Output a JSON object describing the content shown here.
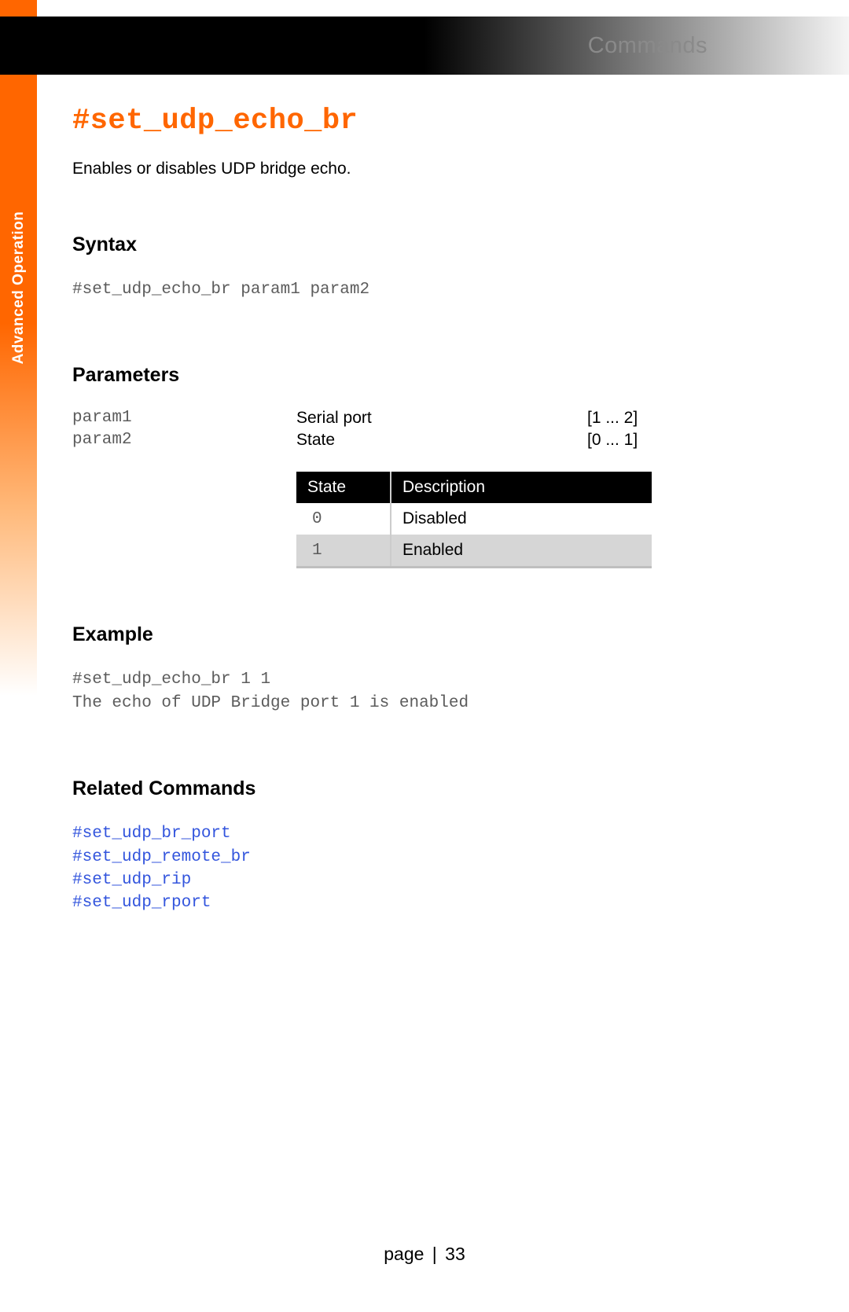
{
  "header": {
    "title": "Commands"
  },
  "sidebar": {
    "label": "Advanced Operation"
  },
  "command": {
    "title": "#set_udp_echo_br",
    "description": "Enables or disables UDP bridge echo."
  },
  "syntax": {
    "heading": "Syntax",
    "code": "#set_udp_echo_br param1 param2"
  },
  "parameters": {
    "heading": "Parameters",
    "rows": [
      {
        "name": "param1",
        "desc": "Serial port",
        "range": "[1 ... 2]"
      },
      {
        "name": "param2",
        "desc": "State",
        "range": "[0 ... 1]"
      }
    ],
    "state_table": {
      "headers": {
        "state": "State",
        "desc": "Description"
      },
      "rows": [
        {
          "state": "0",
          "desc": "Disabled"
        },
        {
          "state": "1",
          "desc": "Enabled"
        }
      ]
    }
  },
  "example": {
    "heading": "Example",
    "code": "#set_udp_echo_br 1 1\nThe echo of UDP Bridge port 1 is enabled"
  },
  "related": {
    "heading": "Related Commands",
    "links": [
      "#set_udp_br_port",
      "#set_udp_remote_br",
      "#set_udp_rip",
      "#set_udp_rport"
    ]
  },
  "footer": {
    "label": "page",
    "sep": "|",
    "num": "33"
  }
}
